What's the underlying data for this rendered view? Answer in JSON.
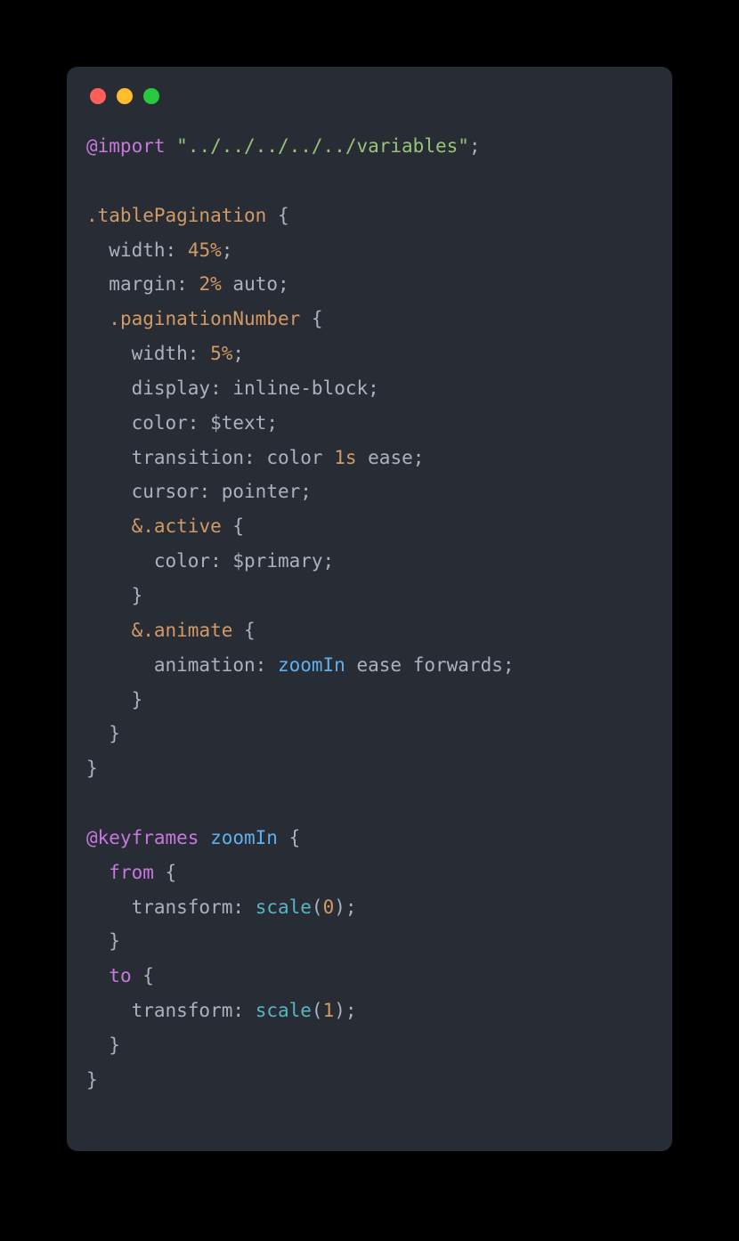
{
  "titlebar": {
    "dot_red": "close",
    "dot_yellow": "minimize",
    "dot_green": "zoom"
  },
  "code": {
    "l1_kw": "@import",
    "l1_str": "\"../../../../../variables\"",
    "l2_sel": ".tablePagination",
    "l3_prop": "width",
    "l3_val": "45%",
    "l4_prop": "margin",
    "l4_val1": "2%",
    "l4_val2": "auto",
    "l5_sel": ".paginationNumber",
    "l6_prop": "width",
    "l6_val": "5%",
    "l7_prop": "display",
    "l7_val": "inline-block",
    "l8_prop": "color",
    "l8_val": "$text",
    "l9_prop": "transition",
    "l9_val1": "color",
    "l9_val2": "1s",
    "l9_val3": "ease",
    "l10_prop": "cursor",
    "l10_val": "pointer",
    "l11_amp": "&",
    "l11_sel": ".active",
    "l12_prop": "color",
    "l12_val": "$primary",
    "l13_amp": "&",
    "l13_sel": ".animate",
    "l14_prop": "animation",
    "l14_val1": "zoomIn",
    "l14_val2": "ease",
    "l14_val3": "forwards",
    "l15_kw": "@keyframes",
    "l15_name": "zoomIn",
    "l16_kw": "from",
    "l17_prop": "transform",
    "l17_fn": "scale",
    "l17_arg": "0",
    "l18_kw": "to",
    "l19_prop": "transform",
    "l19_fn": "scale",
    "l19_arg": "1",
    "brace_open": "{",
    "brace_close": "}",
    "semi": ";",
    "colon": ":",
    "paren_open": "(",
    "paren_close": ")"
  }
}
